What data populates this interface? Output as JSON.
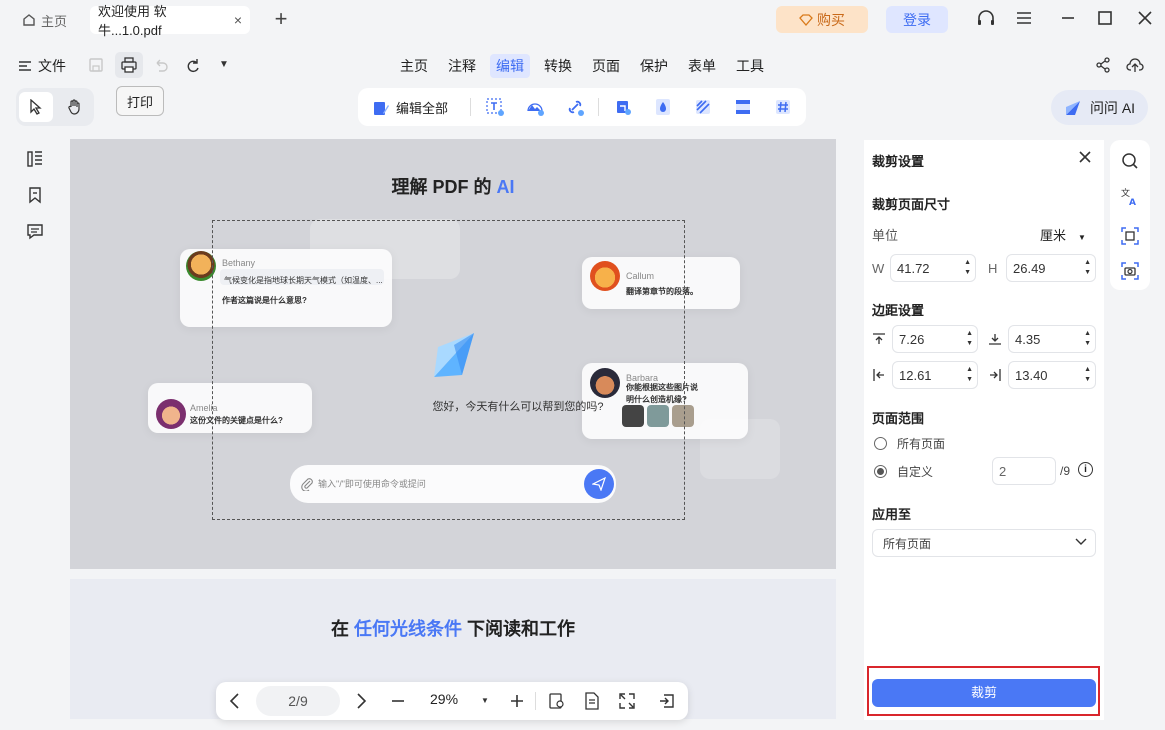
{
  "tabs": {
    "home": "主页",
    "doc": "欢迎使用 软牛...1.0.pdf"
  },
  "titlebar": {
    "buy": "购买",
    "login": "登录"
  },
  "menubar": {
    "file": "文件",
    "items": [
      "主页",
      "注释",
      "编辑",
      "转换",
      "页面",
      "保护",
      "表单",
      "工具"
    ],
    "active": "编辑"
  },
  "toolbar": {
    "print": "打印",
    "edit_all": "编辑全部",
    "ask_ai": "问问 AI"
  },
  "page1": {
    "title_prefix": "理解 PDF 的 ",
    "title_ai": "AI",
    "greeting": "您好，今天有什么可以帮到您的吗?",
    "input_placeholder": "输入\"/\"即可使用命令或提问",
    "bethany_name": "Bethany",
    "bethany_q": "气候变化是指地球长期天气模式（如温度、...",
    "bethany_q2": "作者这篇说是什么意思?",
    "callum_name": "Callum",
    "callum_text": "翻译第章节的段落。",
    "barbara_name": "Barbara",
    "barbara_text": "你能根据这些图片说明什么创造机缘?",
    "amelia_name": "Amelia",
    "amelia_text": "这份文件的关键点是什么?"
  },
  "page2": {
    "prefix": "在 ",
    "highlight": "任何光线条件",
    "suffix": " 下阅读和工作"
  },
  "bottom": {
    "page": "2/9",
    "zoom": "29%"
  },
  "panel": {
    "title": "裁剪设置",
    "size_title": "裁剪页面尺寸",
    "unit_label": "单位",
    "unit_value": "厘米",
    "w_label": "W",
    "w_value": "41.72",
    "h_label": "H",
    "h_value": "26.49",
    "margin_title": "边距设置",
    "top": "7.26",
    "bottom": "4.35",
    "left": "12.61",
    "right": "13.40",
    "range_title": "页面范围",
    "all_pages": "所有页面",
    "custom": "自定义",
    "custom_value": "2",
    "total": "/9",
    "apply_title": "应用至",
    "apply_value": "所有页面",
    "crop_button": "裁剪"
  },
  "colors": {
    "accent": "#4a78f5",
    "highlight_red": "#d9262c",
    "buy_bg": "#fde3c8"
  }
}
